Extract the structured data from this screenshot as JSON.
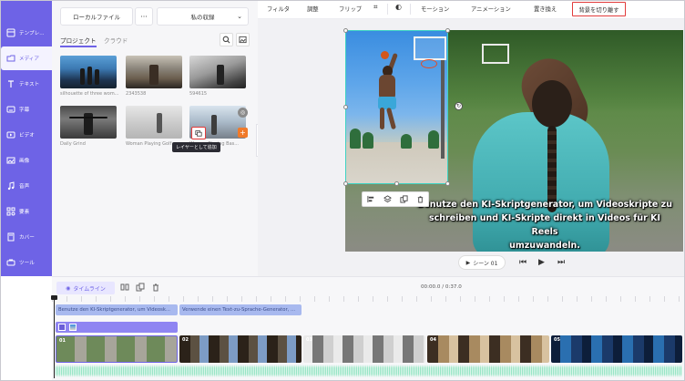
{
  "sidebar": {
    "items": [
      {
        "label": "テンプレ...",
        "icon": "template-icon"
      },
      {
        "label": "メディア",
        "icon": "folder-icon"
      },
      {
        "label": "テキスト",
        "icon": "text-icon"
      },
      {
        "label": "字幕",
        "icon": "subtitle-icon"
      },
      {
        "label": "ビデオ",
        "icon": "video-icon"
      },
      {
        "label": "画像",
        "icon": "image-icon"
      },
      {
        "label": "音声",
        "icon": "music-icon"
      },
      {
        "label": "要素",
        "icon": "elements-icon"
      },
      {
        "label": "カバー",
        "icon": "cover-icon"
      },
      {
        "label": "ツール",
        "icon": "tools-icon"
      }
    ]
  },
  "media": {
    "local_files": "ローカルファイル",
    "more": "···",
    "collection": "私の収録",
    "tabs": {
      "project": "プロジェクト",
      "cloud": "クラウド"
    },
    "thumbs": [
      {
        "label": "silhouette of three wom..."
      },
      {
        "label": "2343538"
      },
      {
        "label": "594615"
      },
      {
        "label": "Daily Grind"
      },
      {
        "label": "Woman Playing Golf"
      },
      {
        "label": "Woman Playing Bas..."
      }
    ],
    "tooltip": "レイヤーとして追加"
  },
  "toolbar": {
    "filter": "フィルタ",
    "adjust": "調整",
    "flip": "フリップ",
    "motion": "モーション",
    "animation": "アニメーション",
    "replace": "置き換え",
    "remove_bg": "背景を切り離す"
  },
  "canvas": {
    "subtitle": "Benutze den KI-Skriptgenerator, um Videoskripte zu\nschreiben und KI-Skripte direkt in Videos für KI Reels\numzuwandeln."
  },
  "playback": {
    "scene": "シーン 01"
  },
  "timeline": {
    "label": "タイムライン",
    "time": "00:00.0 / 0:37.0",
    "subtitle_clips": [
      "Benutze den KI-Skriptgenerator, um Videosk...",
      "Verwende einen Text-zu-Sprache-Generator, ..."
    ],
    "video_clips": [
      "01",
      "02",
      "03",
      "04",
      "05"
    ]
  },
  "colors": {
    "accent": "#6e63e6",
    "highlight_border": "#e23b3b",
    "selection": "#3ed3c3"
  }
}
